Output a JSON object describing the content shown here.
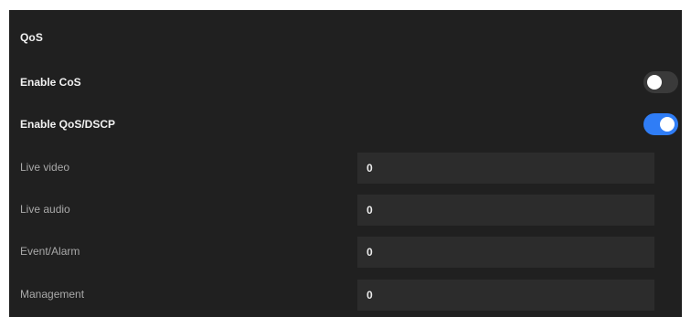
{
  "panel": {
    "title": "QoS"
  },
  "toggles": [
    {
      "label": "Enable CoS",
      "state": "off"
    },
    {
      "label": "Enable QoS/DSCP",
      "state": "on"
    }
  ],
  "fields": [
    {
      "label": "Live video",
      "value": "0"
    },
    {
      "label": "Live audio",
      "value": "0"
    },
    {
      "label": "Event/Alarm",
      "value": "0"
    },
    {
      "label": "Management",
      "value": "0"
    }
  ],
  "colors": {
    "panel_background": "#202020",
    "input_background": "#2c2c2c",
    "toggle_on": "#2f7df6",
    "toggle_off": "#3a3a3a"
  }
}
